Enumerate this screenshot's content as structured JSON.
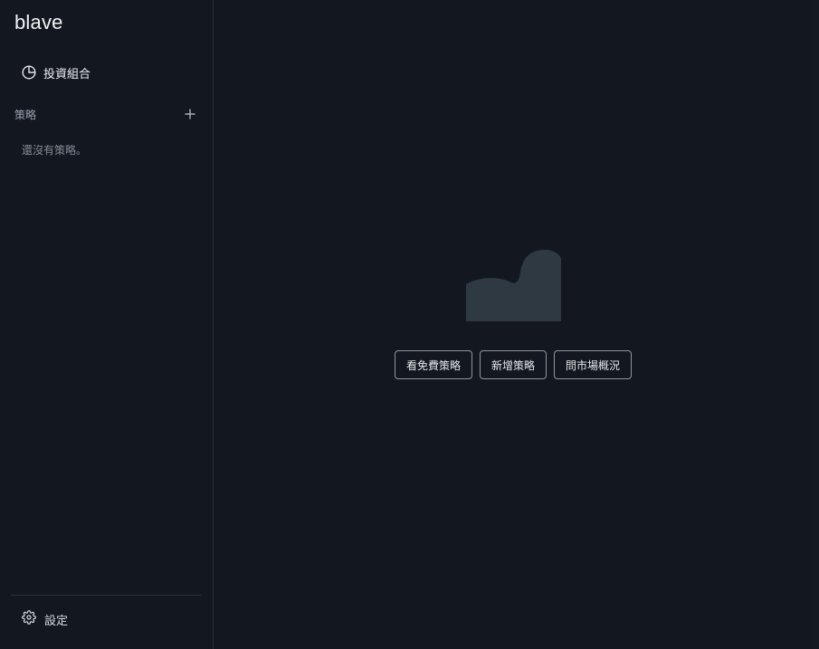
{
  "app": {
    "logo_text": "blave"
  },
  "sidebar": {
    "nav": [
      {
        "label": "投資組合",
        "icon": "pie-chart-icon"
      }
    ],
    "strategies": {
      "title": "策略",
      "add_icon": "plus-icon",
      "empty_text": "還沒有策略。"
    },
    "settings": {
      "label": "設定",
      "icon": "gear-icon"
    }
  },
  "main": {
    "illustration": "empty-chart-illustration",
    "actions": [
      {
        "label": "看免費策略"
      },
      {
        "label": "新增策略"
      },
      {
        "label": "問市場概況"
      }
    ]
  },
  "colors": {
    "background": "#131820",
    "illustration": "#2f3942",
    "button_border": "#8f96a0"
  }
}
